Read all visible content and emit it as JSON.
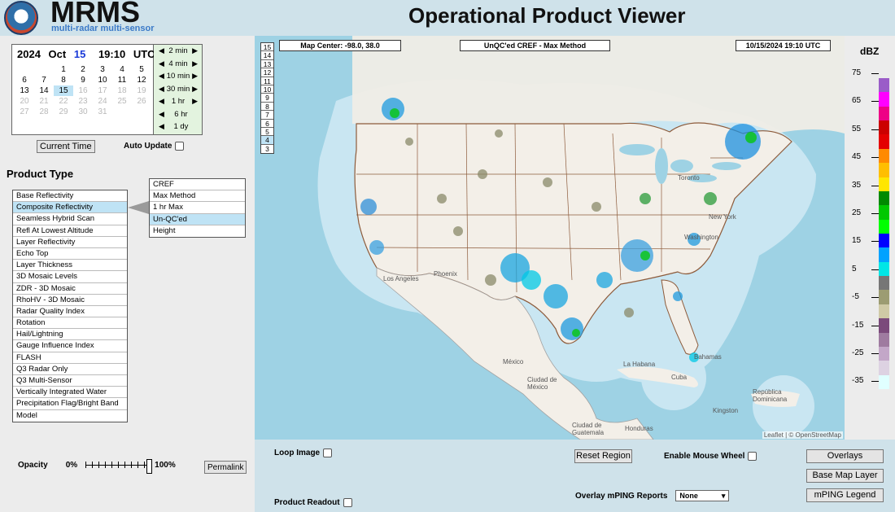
{
  "header": {
    "brand": "MRMS",
    "brand_subtitle": "multi-radar multi-sensor",
    "title": "Operational Product Viewer"
  },
  "calendar": {
    "year": "2024",
    "month": "Oct",
    "day": "15",
    "time": "19:10",
    "tz": "UTC",
    "weeks": [
      [
        "",
        "",
        "1",
        "2",
        "3",
        "4",
        "5"
      ],
      [
        "6",
        "7",
        "8",
        "9",
        "10",
        "11",
        "12"
      ],
      [
        "13",
        "14",
        "15",
        "16",
        "17",
        "18",
        "19"
      ],
      [
        "20",
        "21",
        "22",
        "23",
        "24",
        "25",
        "26"
      ],
      [
        "27",
        "28",
        "29",
        "30",
        "31",
        "",
        ""
      ]
    ],
    "today": "15"
  },
  "time_steps": [
    {
      "label": "2 min",
      "left": "◀",
      "right": "▶"
    },
    {
      "label": "4 min",
      "left": "◀",
      "right": "▶"
    },
    {
      "label": "10 min",
      "left": "◀",
      "right": "▶"
    },
    {
      "label": "30 min",
      "left": "◀",
      "right": "▶"
    },
    {
      "label": "1 hr",
      "left": "◀",
      "right": "▶"
    },
    {
      "label": "6 hr",
      "left": "◀",
      "right": ""
    },
    {
      "label": "1 dy",
      "left": "◀",
      "right": ""
    }
  ],
  "controls": {
    "current_time": "Current Time",
    "auto_update": "Auto Update",
    "permalink": "Permalink",
    "opacity_label": "Opacity",
    "opacity_min": "0%",
    "opacity_max": "100%",
    "opacity_value": 1.0
  },
  "product_type": {
    "heading": "Product Type",
    "items": [
      "Base Reflectivity",
      "Composite Reflectivity",
      "Seamless Hybrid Scan",
      "Refl At Lowest Altitude",
      "Layer Reflectivity",
      "Echo Top",
      "Layer Thickness",
      "3D Mosaic Levels",
      "ZDR - 3D Mosaic",
      "RhoHV - 3D Mosaic",
      "Radar Quality Index",
      "Rotation",
      "Hail/Lightning",
      "Gauge Influence Index",
      "FLASH",
      "Q3 Radar Only",
      "Q3 Multi-Sensor",
      "Vertically Integrated Water",
      "Precipitation Flag/Bright Band",
      "Model"
    ],
    "selected": "Composite Reflectivity",
    "sub_items": [
      "CREF",
      "Max Method",
      "1 hr Max",
      "Un-QC'ed",
      "Height"
    ],
    "sub_selected": "Un-QC'ed"
  },
  "map": {
    "levels": [
      "15",
      "14",
      "13",
      "12",
      "11",
      "10",
      "9",
      "8",
      "7",
      "6",
      "5",
      "4",
      "3"
    ],
    "selected_level": "4",
    "center_label": "Map Center: -98.0, 38.0",
    "product_label": "UnQC'ed CREF - Max Method",
    "time_label": "10/15/2024   19:10 UTC",
    "attribution": "Leaflet | © OpenStreetMap",
    "places": [
      "Los Angeles",
      "Phoenix",
      "Toronto",
      "New York",
      "Washington",
      "México",
      "Ciudad de México",
      "La Habana",
      "Cuba",
      "Bahamas",
      "República Dominicana",
      "Kingston",
      "Ciudad de Guatemala",
      "Honduras"
    ]
  },
  "legend": {
    "title": "dBZ",
    "ticks": [
      "75",
      "65",
      "55",
      "45",
      "35",
      "25",
      "15",
      "5",
      "-5",
      "-15",
      "-25",
      "-35"
    ],
    "colors": [
      "#9a5cc8",
      "#ff00ff",
      "#ee0086",
      "#cc0000",
      "#e40000",
      "#ff8a00",
      "#ffbe00",
      "#ffe600",
      "#008a00",
      "#00c800",
      "#00ff00",
      "#0000ff",
      "#00a2ff",
      "#00e6e6",
      "#767676",
      "#9c9c72",
      "#cfcaa6",
      "#7b4a7b",
      "#9f7ba0",
      "#c3a7c8",
      "#ddd2e2",
      "#e0ffff"
    ]
  },
  "bottom": {
    "loop_image": "Loop Image",
    "product_readout": "Product Readout",
    "reset_region": "Reset Region",
    "enable_mouse_wheel": "Enable Mouse Wheel",
    "overlay_mping": "Overlay mPING Reports",
    "mping_value": "None",
    "overlays": "Overlays",
    "base_map_layer": "Base Map Layer",
    "mping_legend": "mPING Legend"
  }
}
